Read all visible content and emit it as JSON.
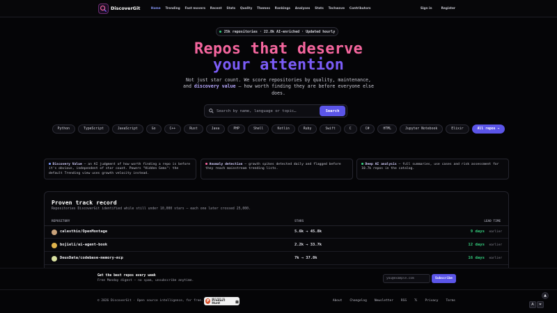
{
  "nav": {
    "brand": "DiscoverGit",
    "links": [
      "Home",
      "Trending",
      "Fast movers",
      "Recent",
      "Stats",
      "Quality",
      "Themes",
      "Rankings",
      "Analyses",
      "Stats",
      "Techwave",
      "Contributors"
    ],
    "sign_in": "Sign in",
    "register": "Register"
  },
  "hero": {
    "pill": "25k repositories · 22.8k AI-enriched · Updated hourly",
    "title_line1": "Repos that deserve",
    "title_line2": "your attention",
    "sub_part1": "Not just star count. We score repositories by quality, maintenance,",
    "sub_part2": "and ",
    "sub_highlight": "discovery value",
    "sub_part3": " — how worth finding they are before everyone else does."
  },
  "search": {
    "placeholder": "Search by name, language or topic…",
    "button": "Search"
  },
  "languages": [
    "Python",
    "TypeScript",
    "JavaScript",
    "Go",
    "C++",
    "Rust",
    "Java",
    "PHP",
    "Shell",
    "Kotlin",
    "Ruby",
    "Swift",
    "C",
    "C#",
    "HTML",
    "Jupyter Notebook",
    "Elixir"
  ],
  "all_repos": "All repos →",
  "features": [
    {
      "title": "Discovery Value",
      "text": " — an AI judgment of how worth finding a repo is before it's obvious, independent of star count. Powers \"Hidden Gems\": the default Trending view uses growth velocity instead.",
      "color": "#7b9bff"
    },
    {
      "title": "Anomaly detection",
      "text": " — growth spikes detected daily and flagged before they reach mainstream trending lists.",
      "color": "#f5669e"
    },
    {
      "title": "Deep AI analysis",
      "text": " — full summaries, use cases and risk assessment for 10.7k repos in the catalog.",
      "color": "#35d07f"
    }
  ],
  "track": {
    "title": "Proven track record",
    "subtitle": "Repositories DiscoverGit identified while still under 10,000 stars — each one later crossed 25,000.",
    "col_repo": "REPOSITORY",
    "col_stars": "STARS",
    "col_lead": "LEAD TIME",
    "rows": [
      {
        "name": "calesthio/OpenMontage",
        "stars": "5.6k → 45.8k",
        "lead": "9 days",
        "earlier": "earlier",
        "avatar": "#c9a27a"
      },
      {
        "name": "bojieli/ai-agent-book",
        "stars": "2.2k → 33.7k",
        "lead": "12 days",
        "earlier": "earlier",
        "avatar": "#e0b44c"
      },
      {
        "name": "DeusData/codebase-memory-mcp",
        "stars": "7k → 37.8k",
        "lead": "16 days",
        "earlier": "earlier",
        "avatar": "#d8e0a0"
      }
    ]
  },
  "newsletter": {
    "title": "Get the best repos every week",
    "subtitle": "Free Monday digest — no spam, unsubscribe anytime.",
    "placeholder": "you@example.com",
    "button": "Subscribe"
  },
  "footer": {
    "copyright": "© 2026 DiscoverGit · Open source intelligence, for free.",
    "ph_small": "FEATURED ON",
    "ph_big": "Product Hunt",
    "links": [
      "About",
      "Changelog",
      "Newsletter",
      "RSS"
    ],
    "x": "𝕏",
    "links2": [
      "Privacy",
      "Terms"
    ]
  },
  "fab": {
    "a": "A",
    "b": "⏷",
    "up": "▲"
  },
  "colors": {
    "accent": "#5b55e8",
    "pink": "#f5669e",
    "violet": "#7b5cf7",
    "green": "#35d07f"
  }
}
